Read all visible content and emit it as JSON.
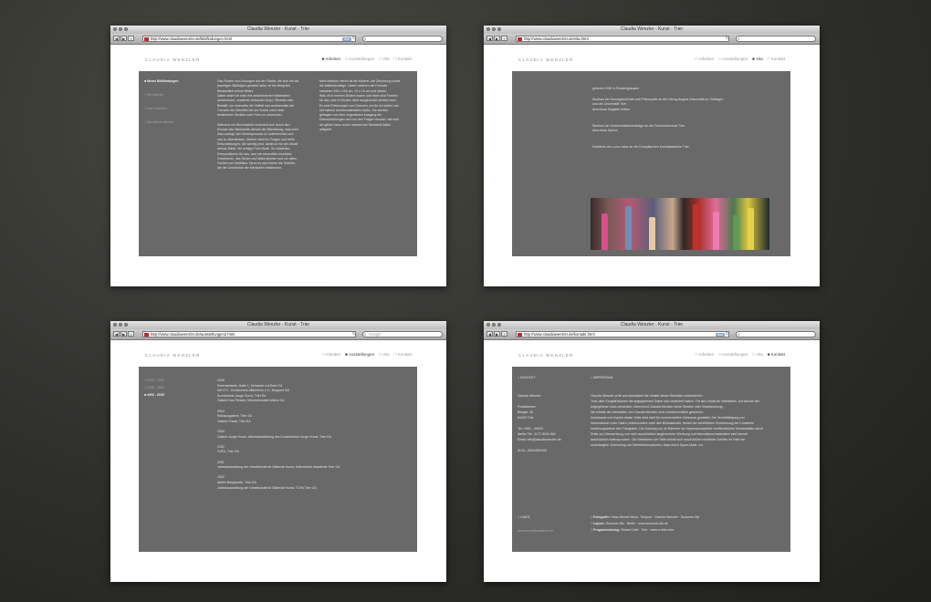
{
  "windows": [
    {
      "title": "Claudia Wenzler - Kunst - Trier",
      "url": "http://www.claudiawenzler.de/bildfindungen.html",
      "rss": "RSS",
      "search": "",
      "brand": "CLAUDIA WENZLER",
      "nav": [
        "Arbeiten",
        "Ausstellungen",
        "Vita",
        "Kontakt"
      ],
      "active_nav": 0,
      "menu": [
        "Meine Bildfindungen",
        "Die Malerei",
        "Das Potenzial",
        "Die Meiner Bücher"
      ],
      "col1": [
        "Das Finden von Lösungen auf der Fläche, die sich mit als",
        "jeweiligen Bildfolgen gewählt habe, ist ein integraler",
        "Bestandteil meiner Bilder.",
        "Dabei setze ich mich mit verschiedenen Materialien",
        "auseinander, verwende anbauder Acryl, Ölkreide oder",
        "Bleistift, um einerseits die Vielfalt und andererseits die",
        "Grenzen der Machtfel bei der Suche nach einer",
        "bestimmten Struktur oder Form zu erforschen.",
        "",
        "Während ein Bild entsteht verändert sich durch den",
        "Einsatz des Werkstoffs oftmals die Bildwirkung, was mich",
        "dazu zwingt, den Arbeitsprozess zu unterbrechen und",
        "neu zu überdenken. Hierbei steht ich Fragen und treffe",
        "Entscheidungen, die wichtig sind, damit ich für den Inhalt",
        "meiner Bilder, die richtige Form finde. So entstehen",
        "Kompositionen für das, was mir wesentlich erscheint:",
        "Gesehenes, das Sehen und Wahrnehmen und vor allem",
        "Gefühl und Gefühltes. Denn es sind immer die Gefühle,",
        "die die Geschichte der Menschen bestimmen."
      ],
      "col2": [
        "Mein Medium hierfür ist die Malerei, die Zeichnung sowie",
        "die Materialcollage. Dabei variieren die Formate",
        "zwischen 200 x 200 cm, 10 x 10 cm und kleiner.",
        "Was oft in meinen Bildern suche und finde sind Formen",
        "für das, was in Worten nicht ausgedrückt werden kann.",
        "Es sind Erfahrungen von Grenzen, an die ich selbst und",
        "mit meinen Arbeitsmaterialien stoße. Sie werden",
        "getragen von dem ungewissen Ausgang der",
        "Überschreitungen und von den Fragen danach, wie weit",
        "ich gehen kann und in wieweit der Werkstoff dabei",
        "mitspielt."
      ]
    },
    {
      "title": "Claudia Wenzler - Kunst - Trier",
      "url": "http://www.claudiawenzler.de/vita.html",
      "search": "",
      "brand": "CLAUDIA WENZLER",
      "nav": [
        "Arbeiten",
        "Ausstellungen",
        "Vita",
        "Kontakt"
      ],
      "active_nav": 2,
      "lines": [
        "geboren 1961 in Recklinghausen",
        "",
        "Studium der Kunstgeschichte und Philosophie an der Georg-August Universität zu Göttingen",
        "und der Universität Trier",
        "Abschluss Magister Artium",
        "",
        "",
        "Studium der Kommunikationsdesign an der Fachhochschule Trier",
        "Abschluss Diplom",
        "",
        "",
        "Schülerin von Luca Lazar an der Europäischen Kunstakademie Trier"
      ]
    },
    {
      "title": "Claudia Wenzler - Kunst - Trier",
      "url": "http://www.claudiawenzler.de/ausstellungen2.html",
      "search": "Google",
      "brand": "CLAUDIA WENZLER",
      "nav": [
        "Arbeiten",
        "Ausstellungen",
        "Vita",
        "Kontakt"
      ],
      "active_nav": 1,
      "years": [
        "2010 - 2015",
        "2006 - 2009",
        "2000 - 2005"
      ],
      "active_year": 2,
      "lines": [
        "2005",
        "Rohrmeisterei, Halle 1, Schwerte a.d.Ruhr EA",
        "KM 072 - Kunstverein Mittelrhein e.V., Boppard GA",
        "Kunstverein Junge Kunst, Trier EA",
        "Galerie Das Fenster, Mönchenmattel-Mainz GA",
        "",
        "2004",
        "Rathausgalerie, Trier EA",
        "Galerie Praxis, Trier EA",
        "",
        "2003",
        "Galerie Junge Kunst, Jahresausstellung des Kunstvereins Junge Kunst, Trier GA",
        "",
        "2002",
        "TUFA, Trier GA",
        "",
        "2001",
        "Jahresausstellung der Gesellschaft für Bildende Kunst, Katholische Akademie Trier GA",
        "",
        "2000",
        "Atelier Bergstraße, Trier EA",
        "Jahresausstellung der Gesellschaft für Bildende Kunst, TUFA Trier GA"
      ]
    },
    {
      "title": "Claudia Wenzler - Kunst - Trier",
      "url": "http://www.claudiawenzler.de/kontakt.html",
      "rss": "RSS",
      "search": "",
      "brand": "CLAUDIA WENZLER",
      "nav": [
        "Arbeiten",
        "Ausstellungen",
        "Vita",
        "Kontakt"
      ],
      "active_nav": 3,
      "kontakt_head": "KONTAKT:",
      "impressum_head": "IMPRESSUM:",
      "kontakt": [
        "Claudia Wenzler",
        "",
        "Postadresse:",
        "Bergstr. 36",
        "54290 Trier",
        "",
        "Tel.: 0651 - 46693",
        "Atelier Tel.: 0171 8184 564",
        "Email: info@claudiawenzler.de",
        "",
        "St.Nr.: 43/14050/463"
      ],
      "impressum": [
        "Claudia Wenzler prüft und aktualisiert die Inhalte dieser Webseite kontinuierlich.",
        "Trotz aller Sorgfalt können die angegebenen Daten sich verändert haben. Für den Inhalt der Webseiten, auf welche hier",
        "angegebene Links verweisen, übernimmt Claudia Wenzler keine Gewähr oder Verantwortung.",
        "Die Inhalte der Webseiten von Claudia Wenzler sind urheberrechtlich geschützt.",
        "Downloads und Kopien dieser Seite sind nicht für kommerziellen Gebrauch gestattet. Die Vervielfältigung von",
        "Informationen oder Daten, insbesondere auch des Bildmaterials, bedarf der schriftlichen Zustimmung der Künstlerin",
        "beziehungsweise des Fotografen. Die Nutzung von im Rahmen der Impressumspflicht veröffentlichten Kontaktdaten durch",
        "Dritte zur Übersendung von nicht ausdrücklich angeforderter Werbung und Informationsmaterialien wird hiermit",
        "ausdrücklich widersprochen. Die Betreiberin der Seite behält sich ausdrücklich rechtliche Schritte im Falle der",
        "unverlangten Zusendung von Werbeinformationen, etwa durch Spam-Mails, vor."
      ],
      "links_head": "LINKS:",
      "links_url": "www.europalkunsttrier.de",
      "credits": [
        {
          "label": "Fotografie:",
          "text": "Hans-Werner Bohn, Trimport · Claudia Wenzler · Susanne Zils"
        },
        {
          "label": "Layout:",
          "text": "Susanne Zils · Berlin · www.susanne-zils.de"
        },
        {
          "label": "Programmierung:",
          "text": "Roland Zahl · Trier · www.rz-trier.com"
        }
      ]
    }
  ]
}
